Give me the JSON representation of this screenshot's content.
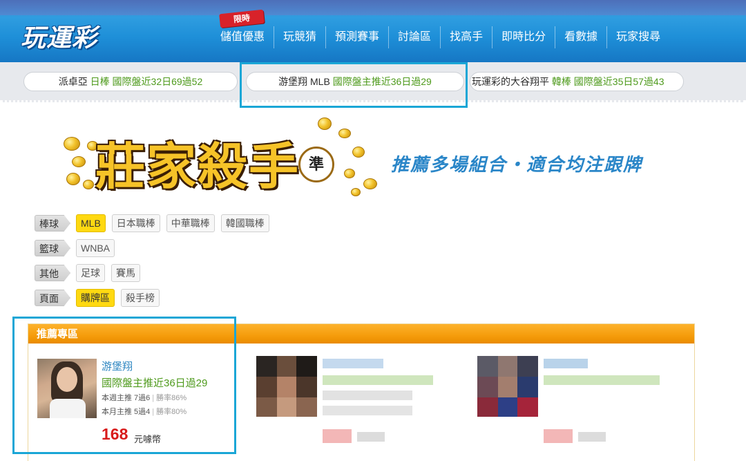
{
  "brand": {
    "logo_text": "玩運彩"
  },
  "nav": {
    "limited_badge": "限時",
    "items": [
      "儲值優惠",
      "玩競猜",
      "預測賽事",
      "討論區",
      "找高手",
      "即時比分",
      "看數據",
      "玩家搜尋"
    ]
  },
  "ticker": [
    {
      "name": "派卓亞",
      "sport": "日棒",
      "record": "國際盤近32日69過52"
    },
    {
      "name": "游堡翔",
      "sport": "MLB",
      "record": "國際盤主推近36日過29"
    },
    {
      "name": "玩運彩的大谷翔平",
      "sport": "韓棒",
      "record": "國際盤近35日57過43"
    }
  ],
  "banner": {
    "title": "莊家殺手",
    "stamp": "準",
    "slogan": "推薦多場組合・適合均注跟牌"
  },
  "filters": [
    {
      "category": "棒球",
      "options": [
        {
          "label": "MLB",
          "active": true
        },
        {
          "label": "日本職棒",
          "active": false
        },
        {
          "label": "中華職棒",
          "active": false
        },
        {
          "label": "韓國職棒",
          "active": false
        }
      ]
    },
    {
      "category": "籃球",
      "options": [
        {
          "label": "WNBA",
          "active": false
        }
      ]
    },
    {
      "category": "其他",
      "options": [
        {
          "label": "足球",
          "active": false
        },
        {
          "label": "賽馬",
          "active": false
        }
      ]
    },
    {
      "category": "頁面",
      "options": [
        {
          "label": "購牌區",
          "active": true
        },
        {
          "label": "殺手榜",
          "active": false
        }
      ]
    }
  ],
  "recommend": {
    "header": "推薦專區",
    "card1": {
      "name": "游堡翔",
      "record": "國際盤主推近36日過29",
      "week_stat": "本週主推 7過6",
      "week_rate": "勝率86%",
      "month_stat": "本月主推 5過4",
      "month_rate": "勝率80%",
      "price": "168",
      "unit": "元噱幣"
    }
  },
  "colors": {
    "accent_blue": "#1aa6d6",
    "nav_blue": "#1e8fd8",
    "header_orange": "#f59c0b",
    "record_green": "#4e9a1c",
    "price_red": "#d81b1b",
    "active_chip": "#ffd911"
  }
}
